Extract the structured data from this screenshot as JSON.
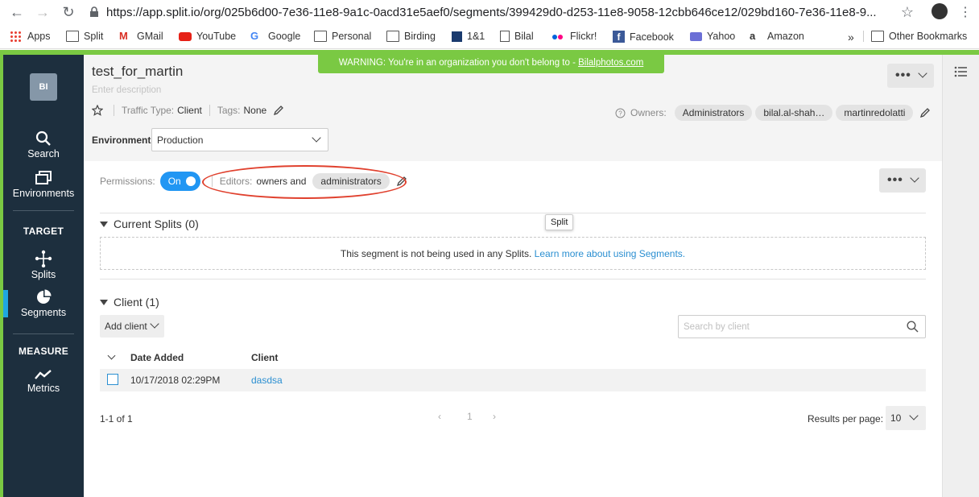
{
  "browser": {
    "url": "https://app.split.io/org/025b6d00-7e36-11e8-9a1c-0acd31e5aef0/segments/399429d0-d253-11e8-9058-12cbb646ce12/029bd160-7e36-11e8-9...",
    "bookmarks": [
      "Apps",
      "Split",
      "GMail",
      "YouTube",
      "Google",
      "Personal",
      "Birding",
      "1&1",
      "Bilal",
      "Flickr!",
      "Facebook",
      "Yahoo",
      "Amazon"
    ],
    "overflow": "»",
    "other_bookmarks": "Other Bookmarks"
  },
  "colors": {
    "accent": "#7ac943",
    "nav_bg": "#1d2f3e",
    "primary": "#2196f3",
    "link": "#2b8fd1",
    "annotation": "#e0412e"
  },
  "leftnav": {
    "avatar": "BI",
    "search": "Search",
    "environments": "Environments",
    "target_heading": "TARGET",
    "splits": "Splits",
    "segments": "Segments",
    "measure_heading": "MEASURE",
    "metrics": "Metrics"
  },
  "header": {
    "warning_text": "WARNING: You're in an organization you don't belong to - ",
    "warning_link": "Bilalphotos.com",
    "title": "test_for_martin",
    "description_placeholder": "Enter description",
    "traffic_type_label": "Traffic Type:",
    "traffic_type_value": "Client",
    "tags_label": "Tags:",
    "tags_value": "None",
    "owners_label": "Owners:",
    "owners": [
      "Administrators",
      "bilal.al-shah…",
      "martinredolatti"
    ],
    "environment_label": "Environment",
    "environment_value": "Production"
  },
  "permissions": {
    "label": "Permissions:",
    "toggle": "On",
    "editors_label": "Editors:",
    "editors_text": "owners and",
    "editors_chip": "administrators"
  },
  "current_splits": {
    "title": "Current Splits (0)",
    "tooltip": "Split",
    "empty_text": "This segment is not being used in any Splits. ",
    "empty_link": "Learn more about using Segments."
  },
  "client": {
    "title": "Client (1)",
    "add_button": "Add client",
    "search_placeholder": "Search by client",
    "columns": [
      "Date Added",
      "Client"
    ],
    "rows": [
      {
        "date": "10/17/2018 02:29PM",
        "client": "dasdsa"
      }
    ],
    "range": "1-1 of 1",
    "page": "1",
    "results_label": "Results per page:",
    "results_value": "10"
  }
}
